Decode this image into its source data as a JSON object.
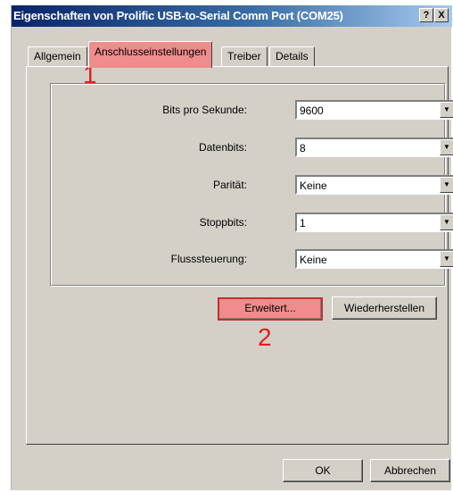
{
  "window": {
    "title": "Eigenschaften von Prolific USB-to-Serial Comm Port (COM25)",
    "help_button": "?",
    "close_button": "X"
  },
  "tabs": [
    {
      "label": "Allgemein",
      "active": false
    },
    {
      "label": "Anschlusseinstellungen",
      "active": true
    },
    {
      "label": "Treiber",
      "active": false
    },
    {
      "label": "Details",
      "active": false
    }
  ],
  "settings": {
    "baud": {
      "label": "Bits pro Sekunde:",
      "value": "9600"
    },
    "databits": {
      "label": "Datenbits:",
      "value": "8"
    },
    "parity": {
      "label": "Parität:",
      "value": "Keine"
    },
    "stopbits": {
      "label": "Stoppbits:",
      "value": "1"
    },
    "flow": {
      "label": "Flusssteuerung:",
      "value": "Keine"
    }
  },
  "buttons": {
    "advanced": "Erweitert...",
    "restore": "Wiederherstellen",
    "ok": "OK",
    "cancel": "Abbrechen"
  },
  "annotations": {
    "step1": "1",
    "step2": "2"
  },
  "colors": {
    "highlight": "#ef8c8c",
    "annotation": "#e02020"
  }
}
